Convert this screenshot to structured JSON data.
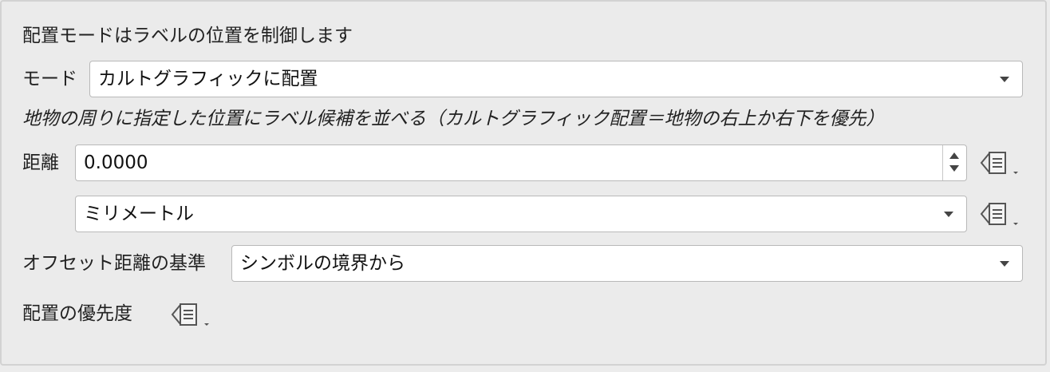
{
  "header": {
    "description": "配置モードはラベルの位置を制御します"
  },
  "mode": {
    "label": "モード",
    "value": "カルトグラフィックに配置"
  },
  "hint": "地物の周りに指定した位置にラベル候補を並べる（カルトグラフィック配置＝地物の右上か右下を優先）",
  "distance": {
    "label": "距離",
    "value": "0.0000"
  },
  "unit": {
    "value": "ミリメートル"
  },
  "offset_reference": {
    "label": "オフセット距離の基準",
    "value": "シンボルの境界から"
  },
  "priority": {
    "label": "配置の優先度"
  },
  "icons": {
    "data_defined_override": "data-defined-override-icon",
    "dropdown_caret": "chevron-down-icon",
    "spin_arrows": "spinbox-arrows-icon"
  }
}
